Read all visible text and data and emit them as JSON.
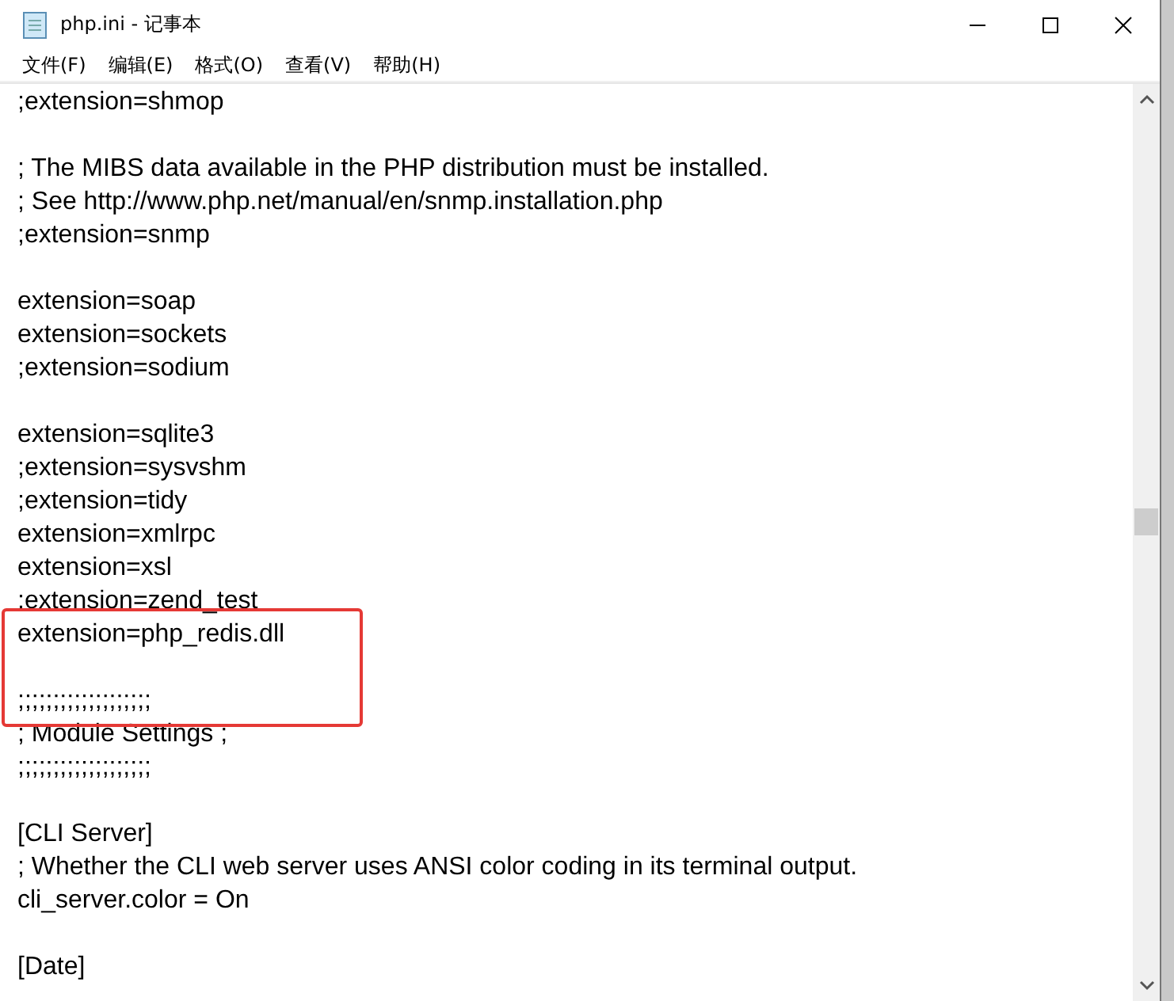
{
  "window": {
    "title": "php.ini - 记事本"
  },
  "menu": [
    "文件(F)",
    "编辑(E)",
    "格式(O)",
    "查看(V)",
    "帮助(H)"
  ],
  "lines": [
    {
      "kind": "text",
      "text": ";extension=shmop"
    },
    {
      "kind": "blank"
    },
    {
      "kind": "text",
      "text": "; The MIBS data available in the PHP distribution must be installed."
    },
    {
      "kind": "text",
      "text": "; See http://www.php.net/manual/en/snmp.installation.php"
    },
    {
      "kind": "text",
      "text": ";extension=snmp"
    },
    {
      "kind": "blank"
    },
    {
      "kind": "text",
      "text": "extension=soap"
    },
    {
      "kind": "text",
      "text": "extension=sockets"
    },
    {
      "kind": "text",
      "text": ";extension=sodium"
    },
    {
      "kind": "blank"
    },
    {
      "kind": "text",
      "text": "extension=sqlite3"
    },
    {
      "kind": "text",
      "text": ";extension=sysvshm"
    },
    {
      "kind": "text",
      "text": ";extension=tidy"
    },
    {
      "kind": "text",
      "text": "extension=xmlrpc"
    },
    {
      "kind": "text",
      "text": "extension=xsl"
    },
    {
      "kind": "text",
      "text": ";extension=zend_test"
    },
    {
      "kind": "highlight",
      "lines": [
        {
          "kind": "text",
          "text": "extension=php_redis.dll"
        },
        {
          "kind": "blank"
        },
        {
          "kind": "text",
          "text": ";;;;;;;;;;;;;;;;;;;"
        }
      ]
    },
    {
      "kind": "text",
      "text": "; Module Settings ;"
    },
    {
      "kind": "text",
      "text": ";;;;;;;;;;;;;;;;;;;"
    },
    {
      "kind": "blank"
    },
    {
      "kind": "text",
      "text": "[CLI Server]"
    },
    {
      "kind": "text",
      "text": "; Whether the CLI web server uses ANSI color coding in its terminal output."
    },
    {
      "kind": "text",
      "text": "cli_server.color = On"
    },
    {
      "kind": "blank"
    },
    {
      "kind": "text",
      "text": "[Date]"
    }
  ]
}
